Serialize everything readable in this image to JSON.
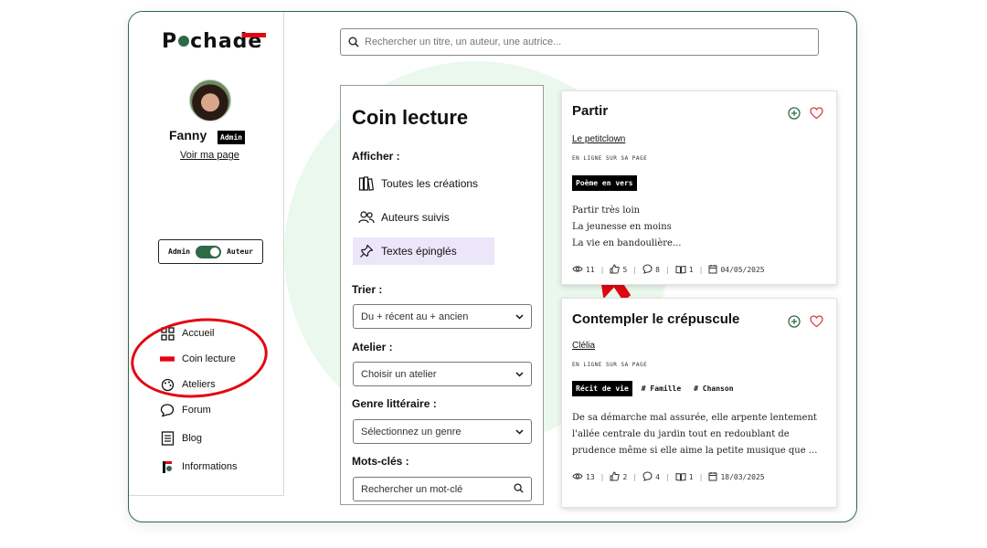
{
  "app": {
    "logo": "Pochade"
  },
  "user": {
    "name": "Fanny",
    "badge": "Admin",
    "profile_link": "Voir ma page"
  },
  "mode_toggle": {
    "left": "Admin",
    "right": "Auteur"
  },
  "nav": [
    {
      "label": "Accueil",
      "icon": "home-icon"
    },
    {
      "label": "Coin lecture",
      "icon": "book-icon"
    },
    {
      "label": "Ateliers",
      "icon": "palette-icon"
    },
    {
      "label": "Forum",
      "icon": "chat-icon"
    },
    {
      "label": "Blog",
      "icon": "newspaper-icon"
    },
    {
      "label": "Informations",
      "icon": "info-logo-icon"
    }
  ],
  "search": {
    "placeholder": "Rechercher un titre, un auteur, une autrice..."
  },
  "filter": {
    "title": "Coin lecture",
    "show_label": "Afficher :",
    "options": [
      {
        "label": "Toutes les créations",
        "icon": "books-icon"
      },
      {
        "label": "Auteurs suivis",
        "icon": "users-icon"
      },
      {
        "label": "Textes épinglés",
        "icon": "pin-icon"
      }
    ],
    "sort_label": "Trier :",
    "sort_value": "Du + récent au + ancien",
    "atelier_label": "Atelier :",
    "atelier_value": "Choisir un atelier",
    "genre_label": "Genre littéraire :",
    "genre_value": "Sélectionnez un genre",
    "keywords_label": "Mots-clés :",
    "keywords_placeholder": "Rechercher un mot-clé"
  },
  "cards": [
    {
      "title": "Partir",
      "author": "Le petitclown",
      "status": "EN LIGNE SUR SA PAGE",
      "genre": "Poème en vers",
      "tags": [],
      "excerpt": [
        "Partir très loin",
        "La jeunesse en moins",
        "La vie en bandoulière..."
      ],
      "views": "11",
      "likes": "5",
      "comments": "8",
      "reads": "1",
      "date": "04/05/2025"
    },
    {
      "title": "Contempler le crépuscule",
      "author": "Clélia",
      "status": "EN LIGNE SUR SA PAGE",
      "genre": "Récit de vie",
      "tags": [
        "# Famille",
        "# Chanson"
      ],
      "excerpt": [
        "De sa démarche mal assurée, elle arpente lentement",
        "l'allée centrale du jardin tout en redoublant de",
        "prudence même si elle aime la petite musique que ..."
      ],
      "views": "13",
      "likes": "2",
      "comments": "4",
      "reads": "1",
      "date": "18/03/2025"
    }
  ],
  "colors": {
    "brand_green": "#2f6a47",
    "brand_red": "#e30613",
    "selected_bg": "#ece6fb"
  }
}
